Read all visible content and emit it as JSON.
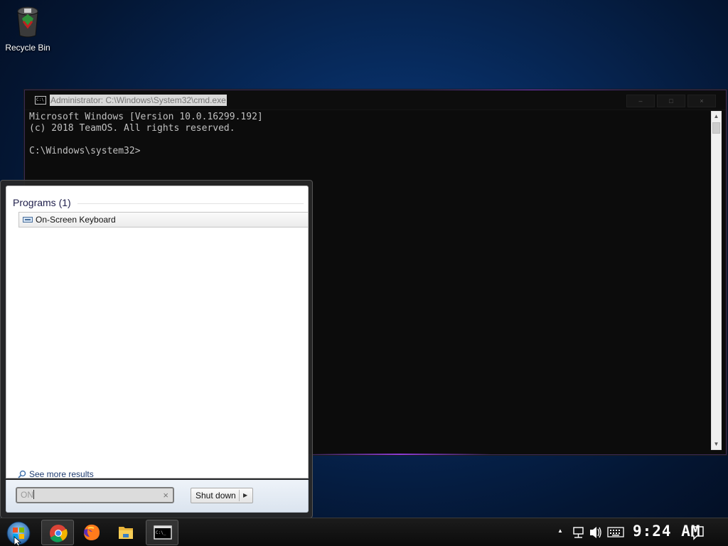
{
  "desktop": {
    "icons": [
      {
        "label": "Recycle Bin",
        "icon": "recycle-bin-icon"
      }
    ]
  },
  "cmd_window": {
    "title": "Administrator: C:\\Windows\\System32\\cmd.exe",
    "controls": {
      "minimize": "–",
      "maximize": "□",
      "close": "×"
    },
    "lines": [
      "Microsoft Windows [Version 10.0.16299.192]",
      "(c) 2018 TeamOS. All rights reserved.",
      "",
      "C:\\Windows\\system32>"
    ]
  },
  "start_menu": {
    "programs_header": "Programs (1)",
    "results": [
      {
        "label": "On-Screen Keyboard",
        "icon": "keyboard-icon"
      }
    ],
    "see_more": "See more results",
    "search": {
      "value": "ON",
      "clear": "×"
    },
    "shutdown_label": "Shut down",
    "shutdown_arrow": "▶"
  },
  "taskbar": {
    "pinned": [
      {
        "name": "chrome",
        "icon": "chrome-icon"
      },
      {
        "name": "firefox",
        "icon": "firefox-icon"
      },
      {
        "name": "file-explorer",
        "icon": "folder-icon"
      },
      {
        "name": "command-prompt",
        "icon": "cmd-icon"
      }
    ],
    "tray_arrow": "▲",
    "clock": "9:24 AM"
  },
  "colors": {
    "desktop_bg": "#072a5c",
    "cmd_bg": "#0c0c0c",
    "cmd_text": "#c0c0c0",
    "accent_glow": "#8a3bd6"
  }
}
